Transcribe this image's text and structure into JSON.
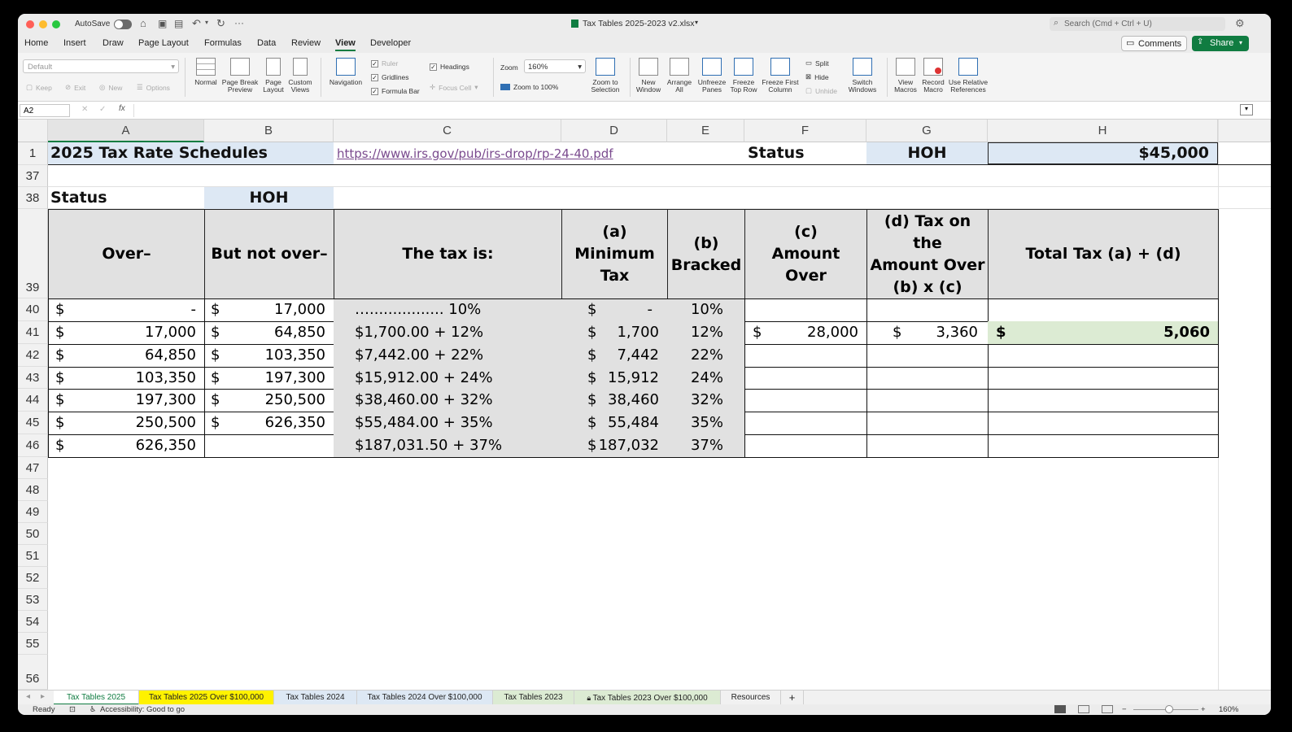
{
  "app": {
    "title": "Tax Tables 2025-2023 v2.xlsx",
    "autosave": "AutoSave",
    "search_placeholder": "Search (Cmd + Ctrl + U)",
    "comments": "Comments",
    "share": "Share"
  },
  "ribbon_tabs": [
    "Home",
    "Insert",
    "Draw",
    "Page Layout",
    "Formulas",
    "Data",
    "Review",
    "View",
    "Developer"
  ],
  "active_tab": "View",
  "ribbon": {
    "sheet_view": "Default",
    "keep": "Keep",
    "exit": "Exit",
    "new": "New",
    "options": "Options",
    "normal": "Normal",
    "page_break": "Page Break",
    "preview": "Preview",
    "page": "Page",
    "layout": "Layout",
    "custom": "Custom",
    "views": "Views",
    "navigation": "Navigation",
    "ruler": "Ruler",
    "gridlines": "Gridlines",
    "formula_bar": "Formula Bar",
    "headings": "Headings",
    "focus_cell": "Focus Cell",
    "zoom": "Zoom",
    "zoom_value": "160%",
    "zoom_100": "Zoom to 100%",
    "zoom_to": "Zoom to",
    "selection": "Selection",
    "new_w": "New",
    "window": "Window",
    "arrange": "Arrange",
    "all": "All",
    "unfreeze": "Unfreeze",
    "panes": "Panes",
    "freeze": "Freeze",
    "top_row": "Top Row",
    "freeze_first": "Freeze First",
    "column": "Column",
    "split": "Split",
    "hide": "Hide",
    "unhide": "Unhide",
    "switch": "Switch",
    "windows": "Windows",
    "view": "View",
    "macros": "Macros",
    "record": "Record",
    "macro": "Macro",
    "use_relative": "Use Relative",
    "references": "References"
  },
  "formula_bar": {
    "name_box": "A2",
    "fx": "fx",
    "formula": ""
  },
  "columns": [
    "A",
    "B",
    "C",
    "D",
    "E",
    "F",
    "G",
    "H"
  ],
  "rows": [
    "1",
    "37",
    "38",
    "39",
    "40",
    "41",
    "42",
    "43",
    "44",
    "45",
    "46",
    "47",
    "48",
    "49",
    "50",
    "51",
    "52",
    "53",
    "54",
    "55",
    "56"
  ],
  "sheet": {
    "r1": {
      "title": "2025 Tax Rate Schedules",
      "link": "https://www.irs.gov/pub/irs-drop/rp-24-40.pdf",
      "status_label": "Status",
      "status_value": "HOH",
      "income": "$45,000"
    },
    "r38": {
      "status_label": "Status",
      "status_value": "HOH"
    },
    "headers": [
      "Over–",
      "But not over–",
      "The tax is:",
      "(a)\nMinimum\nTax",
      "(b)\nBracked",
      "(c)\nAmount Over",
      "(d) Tax on the\nAmount Over\n(b) x (c)",
      "Total Tax (a) + (d)"
    ],
    "brackets": [
      {
        "over": "-",
        "not_over": "17,000",
        "tax": "…................ 10%",
        "min": "-",
        "rate": "10%"
      },
      {
        "over": "17,000",
        "not_over": "64,850",
        "tax": "$1,700.00 + 12%",
        "min": "1,700",
        "rate": "12%"
      },
      {
        "over": "64,850",
        "not_over": "103,350",
        "tax": "$7,442.00 + 22%",
        "min": "7,442",
        "rate": "22%"
      },
      {
        "over": "103,350",
        "not_over": "197,300",
        "tax": "$15,912.00 + 24%",
        "min": "15,912",
        "rate": "24%"
      },
      {
        "over": "197,300",
        "not_over": "250,500",
        "tax": "$38,460.00 + 32%",
        "min": "38,460",
        "rate": "32%"
      },
      {
        "over": "250,500",
        "not_over": "626,350",
        "tax": "$55,484.00 + 35%",
        "min": "55,484",
        "rate": "35%"
      },
      {
        "over": "626,350",
        "not_over": "",
        "tax": "$187,031.50 + 37%",
        "min": "187,032",
        "rate": "37%"
      }
    ],
    "calc": {
      "amount_over": "28,000",
      "tax_on_amount": "3,360",
      "total": "5,060"
    },
    "dollar": "$"
  },
  "sheet_tabs": [
    "Tax Tables 2025",
    "Tax Tables 2025 Over $100,000",
    "Tax Tables 2024",
    "Tax Tables 2024 Over $100,000",
    "Tax Tables 2023",
    "Tax Tables 2023 Over $100,000",
    "Resources",
    "+"
  ],
  "status_bar": {
    "ready": "Ready",
    "accessibility": "Accessibility: Good to go",
    "zoom": "160%"
  },
  "colors": {
    "accent": "#107c41",
    "hoh_fill": "#dde8f4",
    "total_fill": "#dcebd3",
    "tab_yellow": "#fff200",
    "header_fill": "#e1e1e1"
  }
}
